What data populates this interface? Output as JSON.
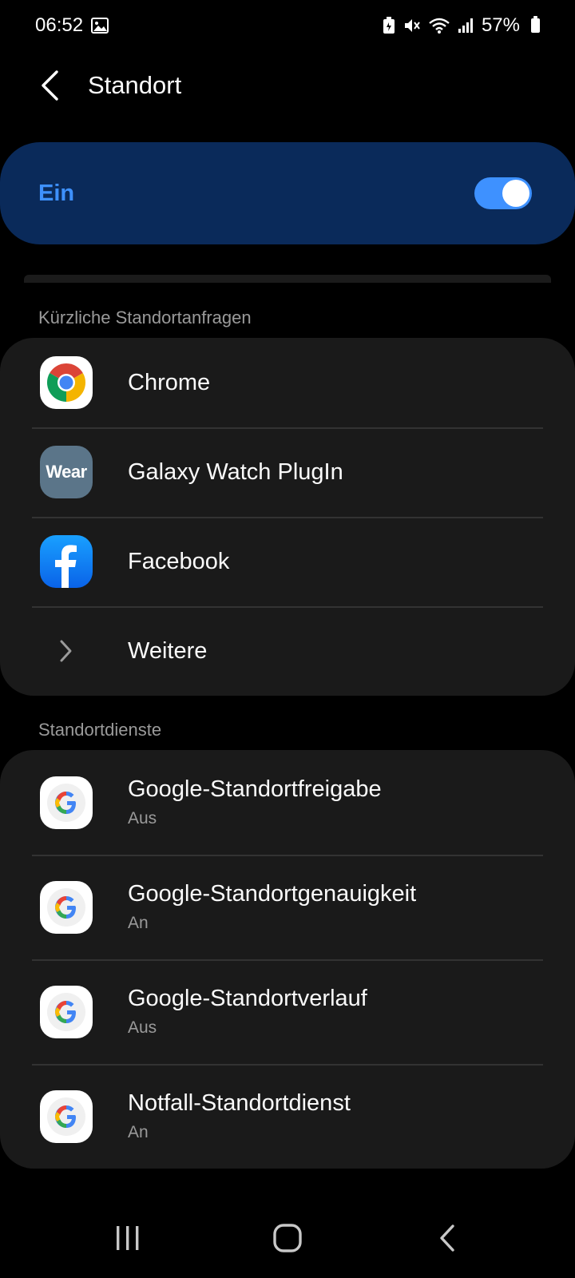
{
  "status_bar": {
    "time": "06:52",
    "battery_percent": "57%",
    "icons": [
      "gallery-icon",
      "battery-saver-icon",
      "mute-icon",
      "wifi-icon",
      "signal-icon",
      "battery-icon"
    ]
  },
  "app_bar": {
    "title": "Standort",
    "back_icon": "back-arrow-icon"
  },
  "master_switch": {
    "label": "Ein",
    "state": true,
    "accent_color": "#3e91ff",
    "background": "#0a2a5a"
  },
  "recent_requests": {
    "header": "Kürzliche Standortanfragen",
    "items": [
      {
        "label": "Chrome",
        "icon": "chrome-icon"
      },
      {
        "label": "Galaxy Watch PlugIn",
        "icon": "wear-icon",
        "icon_text": "Wear"
      },
      {
        "label": "Facebook",
        "icon": "facebook-icon"
      },
      {
        "label": "Weitere",
        "icon": "chevron-right-icon"
      }
    ]
  },
  "services": {
    "header": "Standortdienste",
    "items": [
      {
        "label": "Google-Standortfreigabe",
        "status": "Aus",
        "icon": "google-icon"
      },
      {
        "label": "Google-Standortgenauigkeit",
        "status": "An",
        "icon": "google-icon"
      },
      {
        "label": "Google-Standortverlauf",
        "status": "Aus",
        "icon": "google-icon"
      },
      {
        "label": "Notfall-Standortdienst",
        "status": "An",
        "icon": "google-icon"
      }
    ]
  },
  "nav_bar": {
    "buttons": [
      "recents-icon",
      "home-icon",
      "back-icon"
    ]
  }
}
